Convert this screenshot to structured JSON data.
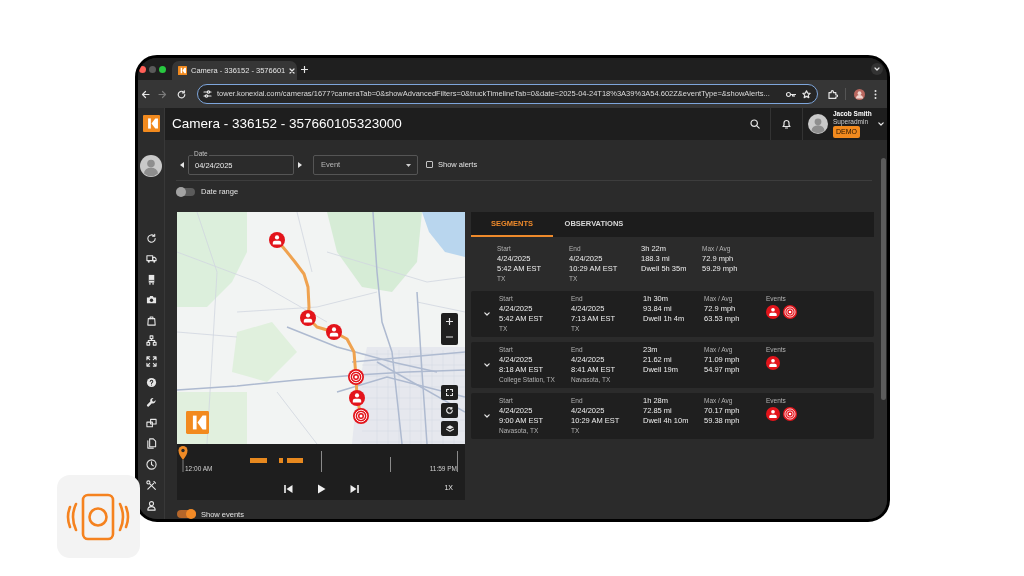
{
  "browser": {
    "tab_title": "Camera - 336152 - 3576601",
    "url": "tower.konexial.com/cameras/1677?cameraTab=0&showAdvancedFilters=0&truckTimelineTab=0&date=2025-04-24T18%3A39%3A54.602Z&eventType=&showAlerts..."
  },
  "header": {
    "title": "Camera - 336152 - 357660105323000",
    "user": {
      "name": "Jacob Smith",
      "role": "Superadmin",
      "badge": "DEMO"
    }
  },
  "filters": {
    "date": {
      "label": "Date",
      "value": "04/24/2025"
    },
    "event_type": {
      "placeholder": "Event"
    },
    "show_alerts": {
      "label": "Show alerts",
      "checked": false
    },
    "date_range": {
      "label": "Date range",
      "on": false
    }
  },
  "map": {
    "markers": [
      {
        "kind": "driver"
      },
      {
        "kind": "driver"
      },
      {
        "kind": "driver"
      },
      {
        "kind": "alert"
      },
      {
        "kind": "driver"
      },
      {
        "kind": "alert"
      }
    ]
  },
  "timeline": {
    "start": "12:00 AM",
    "end": "11:59 PM",
    "level": 0,
    "speed": "1X"
  },
  "show_events": {
    "label": "Show events",
    "on": true
  },
  "tabs": [
    {
      "label": "SEGMENTS",
      "selected": true
    },
    {
      "label": "OBSERVATIONS",
      "selected": false
    }
  ],
  "summary": {
    "start": {
      "label": "Start",
      "date": "4/24/2025",
      "time": "5:42 AM EST",
      "place": "TX"
    },
    "end": {
      "label": "End",
      "date": "4/24/2025",
      "time": "10:29 AM EST",
      "place": "TX"
    },
    "duration": "3h 22m",
    "distance": "188.3 mi",
    "dwell": "Dwell 5h 35m",
    "speed": {
      "label": "Max / Avg",
      "max": "72.9 mph",
      "avg": "59.29 mph"
    }
  },
  "segments": [
    {
      "expanded": false,
      "start": {
        "label": "Start",
        "date": "4/24/2025",
        "time": "5:42 AM EST",
        "place": "TX"
      },
      "end": {
        "label": "End",
        "date": "4/24/2025",
        "time": "7:13 AM EST",
        "place": "TX"
      },
      "duration": "1h 30m",
      "distance": "93.84 mi",
      "dwell": "Dwell 1h 4m",
      "speed": {
        "label": "Max / Avg",
        "max": "72.9 mph",
        "avg": "63.53 mph"
      },
      "events": {
        "label": "Events",
        "items": [
          {
            "kind": "driver"
          },
          {
            "kind": "alert"
          }
        ]
      }
    },
    {
      "expanded": false,
      "start": {
        "label": "Start",
        "date": "4/24/2025",
        "time": "8:18 AM EST",
        "place": "College Station, TX"
      },
      "end": {
        "label": "End",
        "date": "4/24/2025",
        "time": "8:41 AM EST",
        "place": "Navasota, TX"
      },
      "duration": "23m",
      "distance": "21.62 mi",
      "dwell": "Dwell 19m",
      "speed": {
        "label": "Max / Avg",
        "max": "71.09 mph",
        "avg": "54.97 mph"
      },
      "events": {
        "label": "Events",
        "items": [
          {
            "kind": "driver"
          }
        ]
      }
    },
    {
      "expanded": false,
      "start": {
        "label": "Start",
        "date": "4/24/2025",
        "time": "9:00 AM EST",
        "place": "Navasota, TX"
      },
      "end": {
        "label": "End",
        "date": "4/24/2025",
        "time": "10:29 AM EST",
        "place": "TX"
      },
      "duration": "1h 28m",
      "distance": "72.85 mi",
      "dwell": "Dwell 4h 10m",
      "speed": {
        "label": "Max / Avg",
        "max": "70.17 mph",
        "avg": "59.38 mph"
      },
      "events": {
        "label": "Events",
        "items": [
          {
            "kind": "driver"
          },
          {
            "kind": "alert"
          }
        ]
      }
    }
  ]
}
